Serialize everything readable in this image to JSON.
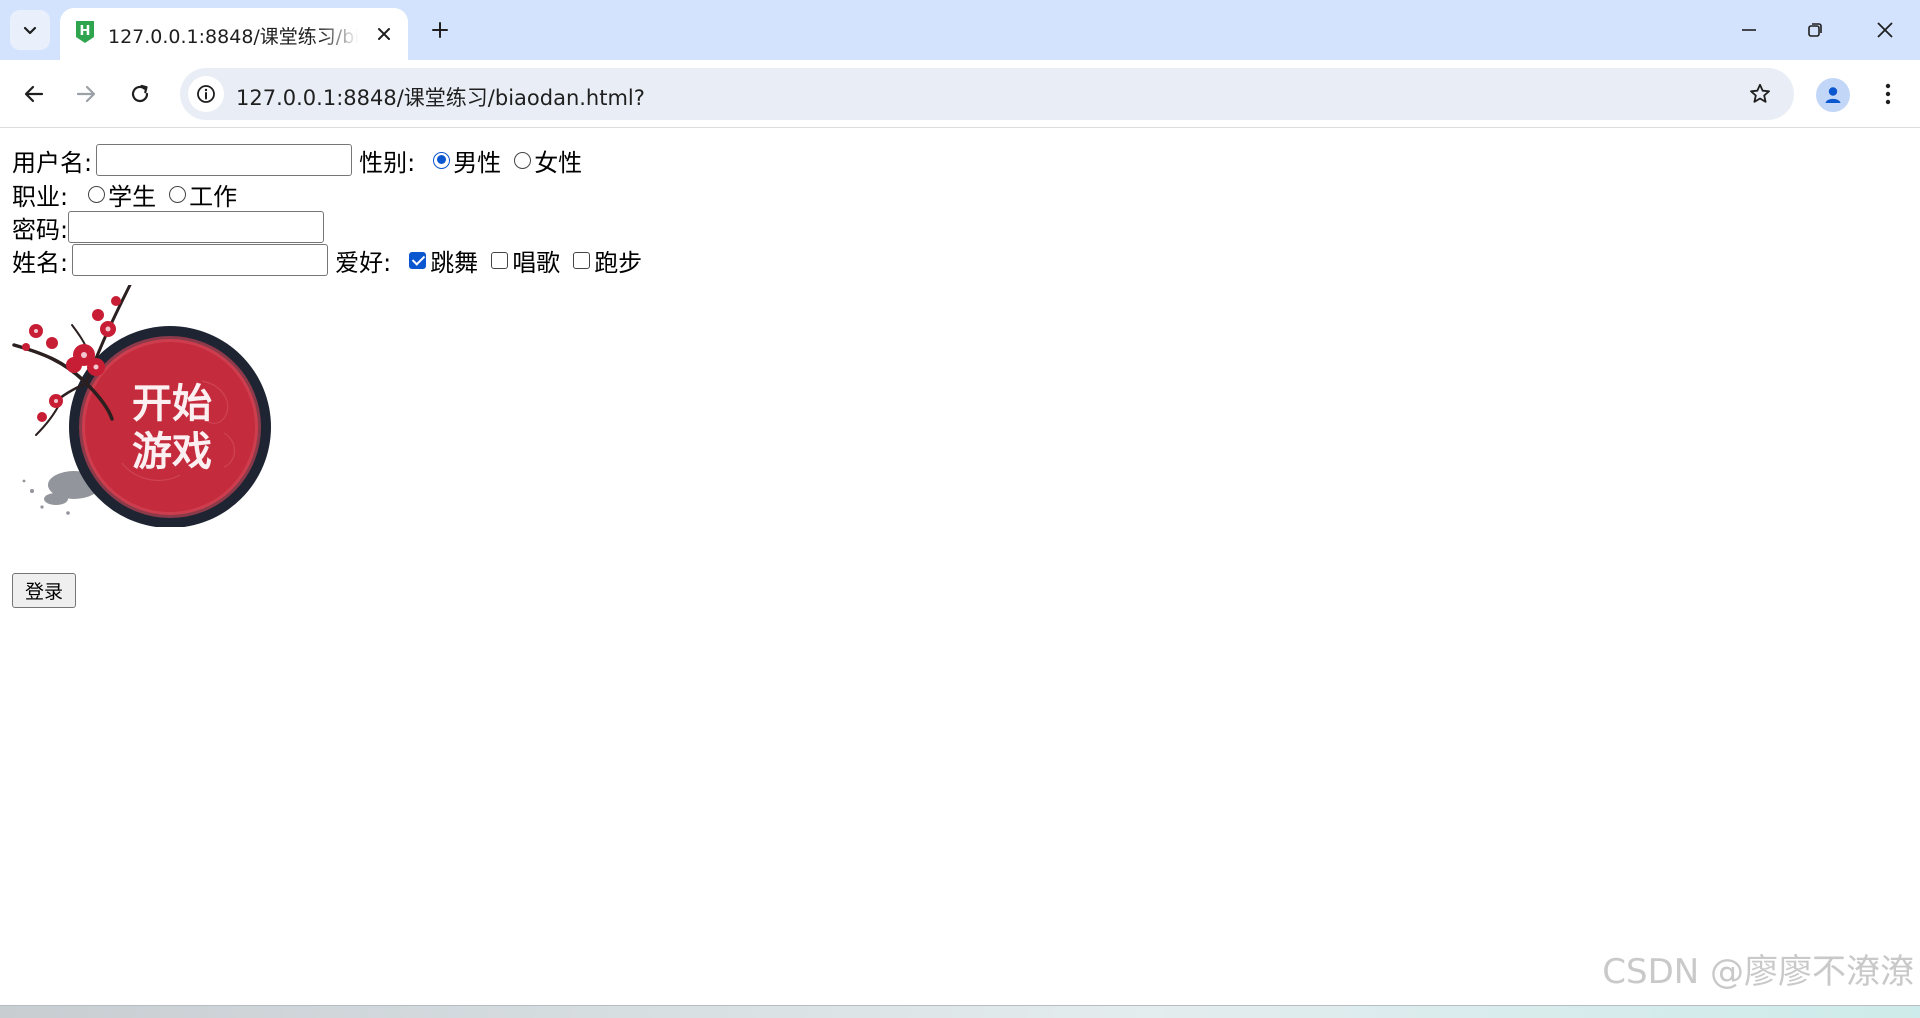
{
  "browser": {
    "tab_title": "127.0.0.1:8848/课堂练习/biaodan.html?",
    "url": "127.0.0.1:8848/课堂练习/biaodan.html?",
    "favicon_letter": "H",
    "favicon_color": "#2ea44f",
    "accent_color": "#0b57d0"
  },
  "form": {
    "username_label": "用户名:",
    "username_value": "",
    "gender_label": "性别:",
    "gender_options": [
      {
        "label": "男性",
        "checked": true
      },
      {
        "label": "女性",
        "checked": false
      }
    ],
    "job_label": "职业:",
    "job_options": [
      {
        "label": "学生",
        "checked": false
      },
      {
        "label": "工作",
        "checked": false
      }
    ],
    "password_label": "密码:",
    "password_value": "",
    "name_label": "姓名:",
    "name_value": "",
    "hobby_label": "爱好:",
    "hobby_options": [
      {
        "label": "跳舞",
        "checked": true
      },
      {
        "label": "唱歌",
        "checked": false
      },
      {
        "label": "跑步",
        "checked": false
      }
    ],
    "image_text_line1": "开始",
    "image_text_line2": "游戏",
    "submit_label": "登录"
  },
  "watermark": "CSDN @廖廖不潦潦"
}
